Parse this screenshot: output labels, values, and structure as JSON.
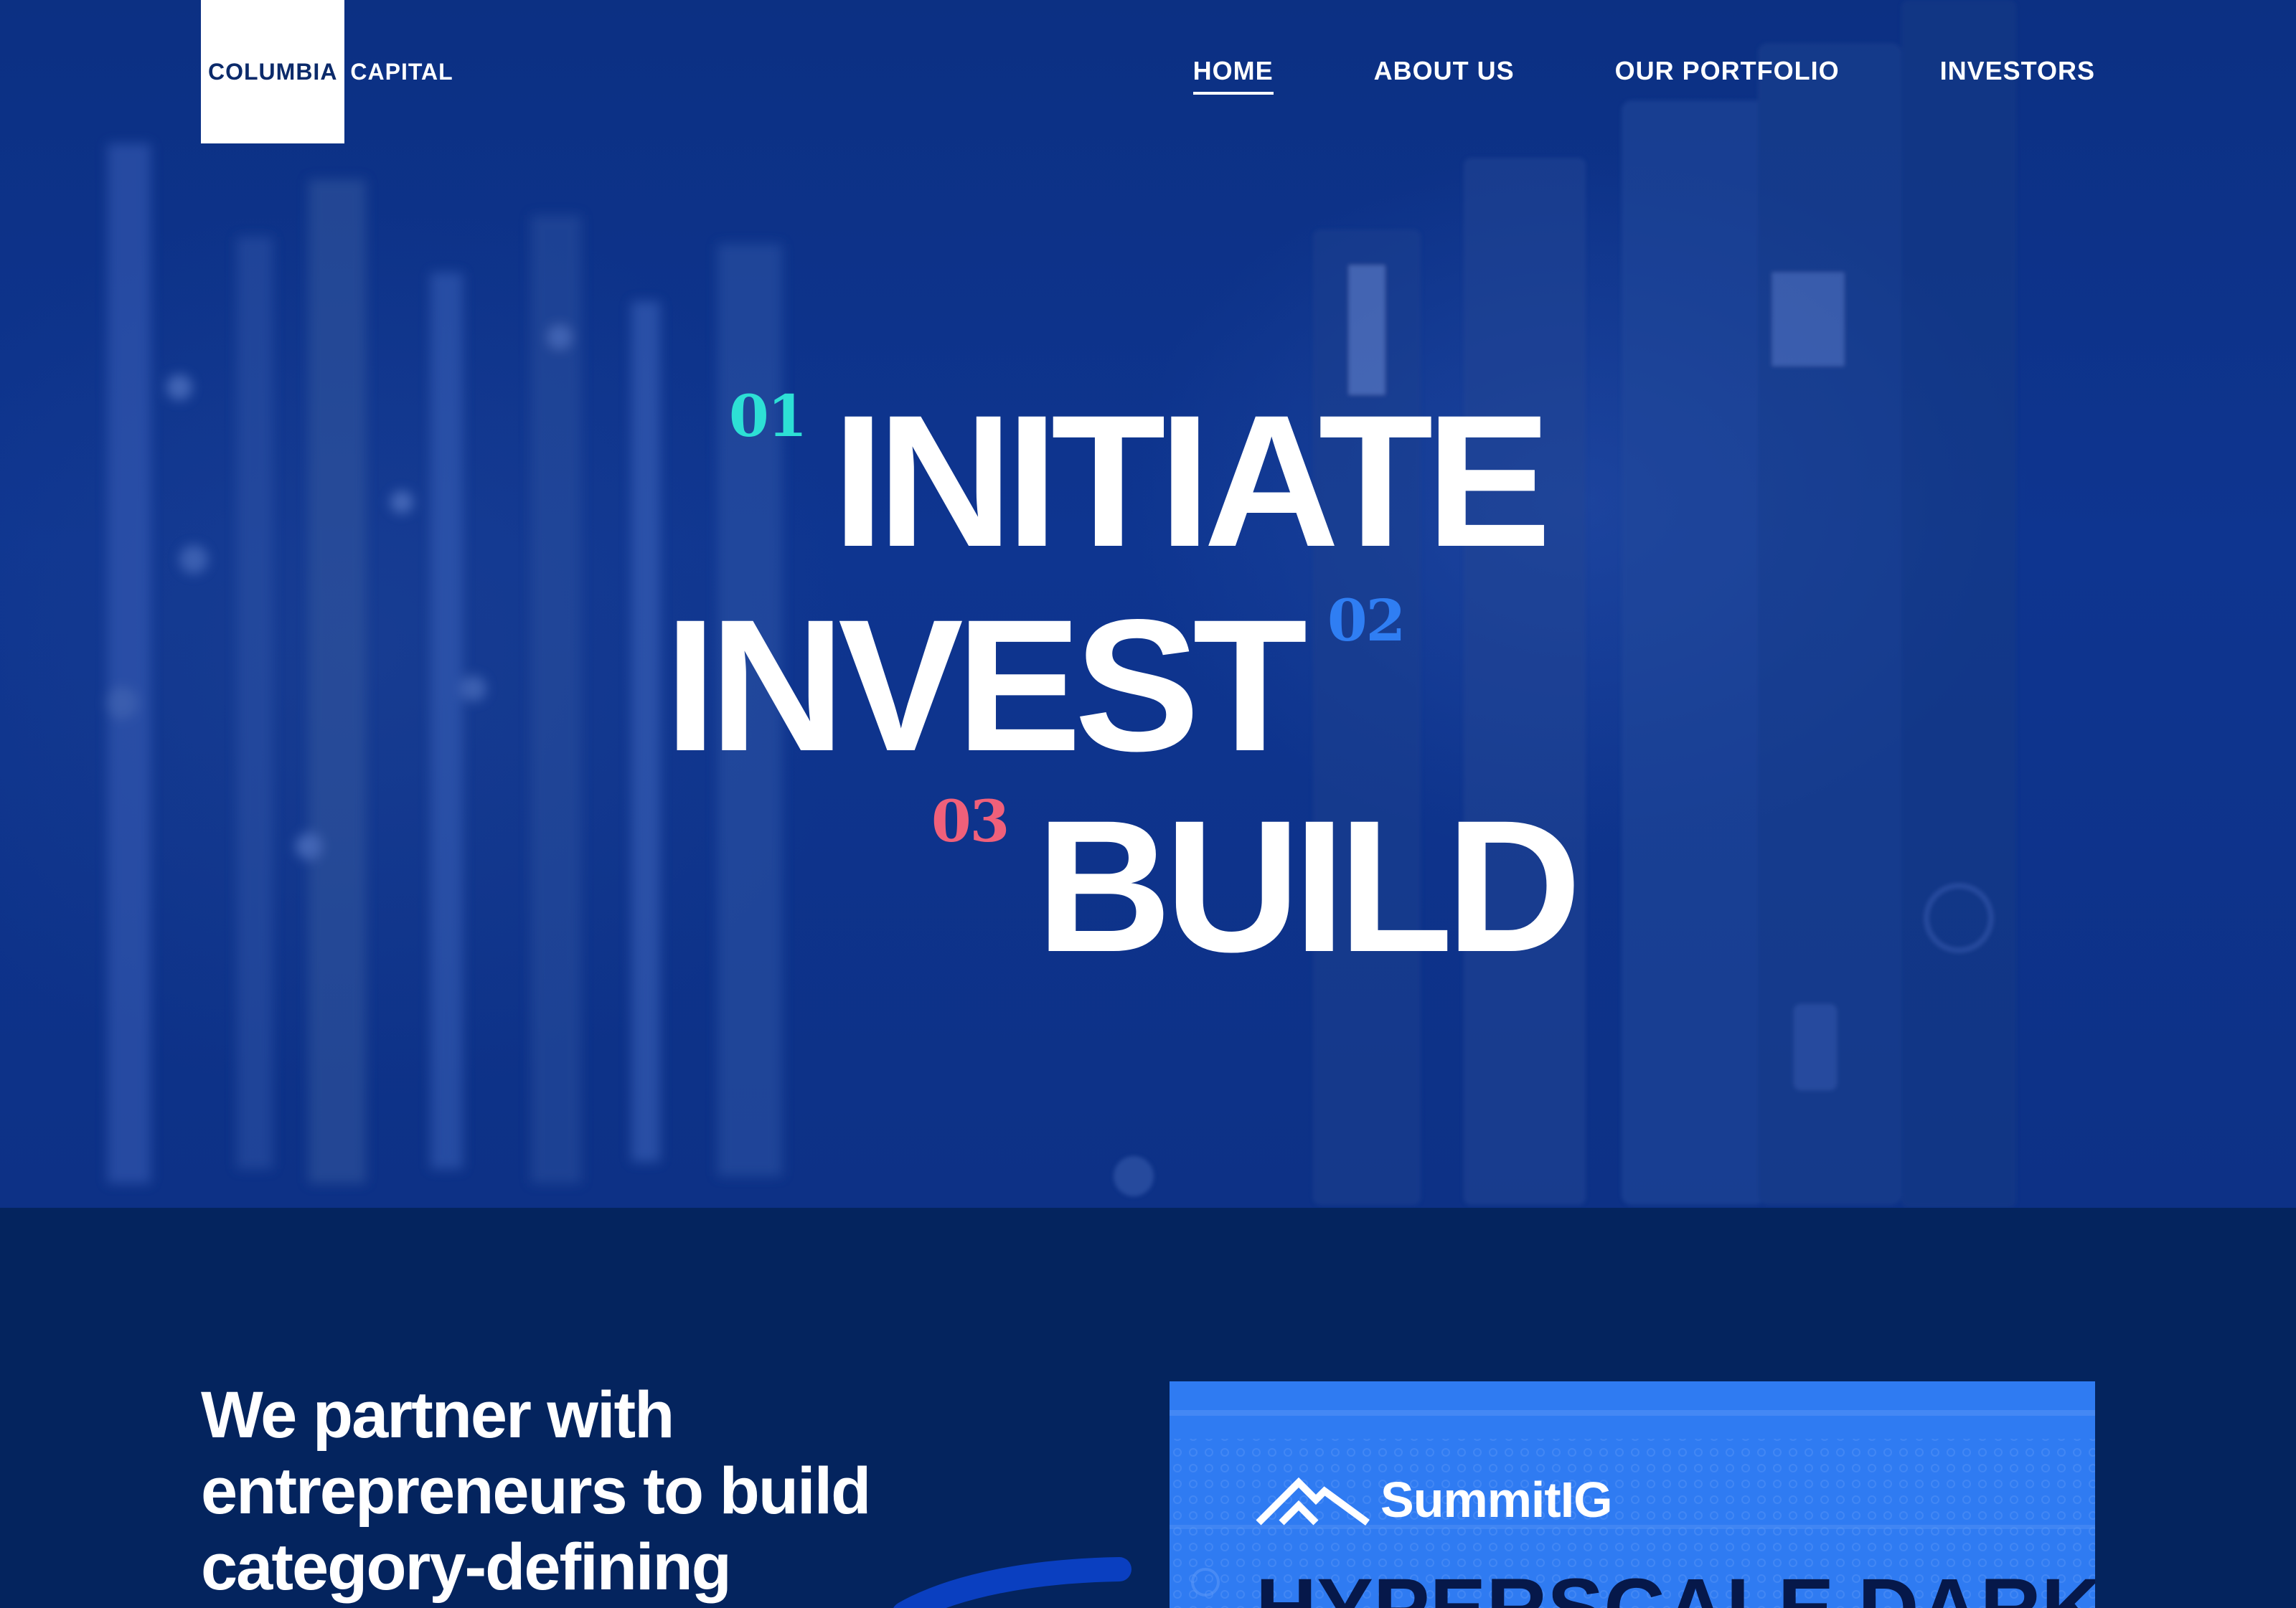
{
  "logo": {
    "part1": "COLUMBIA",
    "part2": "CAPITAL"
  },
  "nav": {
    "items": [
      {
        "label": "HOME",
        "active": true
      },
      {
        "label": "ABOUT US",
        "active": false
      },
      {
        "label": "OUR PORTFOLIO",
        "active": false
      },
      {
        "label": "INVESTORS",
        "active": false
      }
    ]
  },
  "hero": {
    "steps": [
      {
        "number": "01",
        "word": "INITIATE",
        "number_color": "#2de0d5"
      },
      {
        "number": "02",
        "word": "INVEST",
        "number_color": "#2f7ef3"
      },
      {
        "number": "03",
        "word": "BUILD",
        "number_color": "#f0607a"
      }
    ]
  },
  "intro": {
    "line1": "We partner with",
    "line2": "entrepreneurs to build",
    "line3": "category-defining"
  },
  "feature_card": {
    "logo_text": "SummitIG",
    "title": "HYPERSCALE DARK"
  },
  "colors": {
    "page_bg": "#04245e",
    "hero_tint": "#0e3590",
    "card_bg": "#2f7bf2",
    "card_title": "#06184a"
  }
}
